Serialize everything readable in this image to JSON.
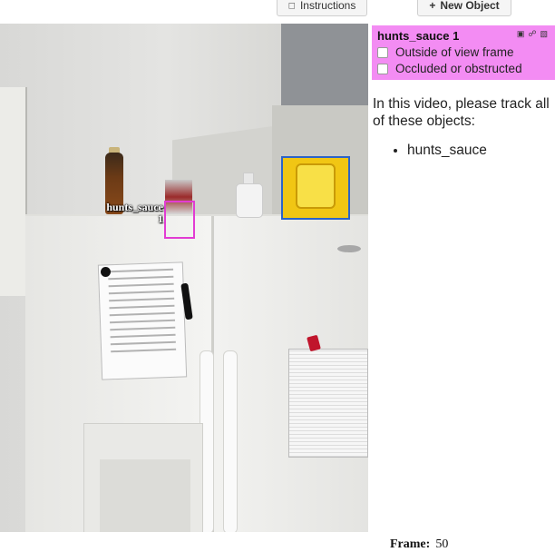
{
  "toolbar": {
    "instructions_label": "Instructions",
    "new_object_label": "New Object"
  },
  "annotation": {
    "label_line1": "hunts_sauce",
    "label_line2": "1",
    "box_color": "#e23cd3"
  },
  "object_card": {
    "title": "hunts_sauce 1",
    "background_color": "#f38cf3",
    "checkbox_outside": "Outside of view frame",
    "checkbox_occluded": "Occluded or obstructed"
  },
  "instructions_text": "In this video, please track all of these objects:",
  "objects_to_track": [
    "hunts_sauce"
  ],
  "frame": {
    "label": "Frame:",
    "value": "50"
  }
}
